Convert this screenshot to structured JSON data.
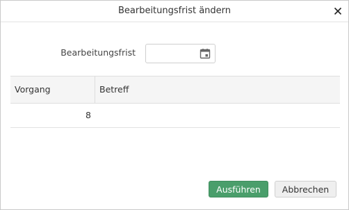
{
  "dialog": {
    "title": "Bearbeitungsfrist ändern",
    "close_icon": "close-icon"
  },
  "form": {
    "deadline_label": "Bearbeitungsfrist",
    "deadline_value": "",
    "calendar_icon": "calendar-icon"
  },
  "table": {
    "columns": [
      "Vorgang",
      "Betreff"
    ],
    "rows": [
      {
        "vorgang": "8",
        "betreff": ""
      }
    ]
  },
  "actions": {
    "execute_label": "Ausführen",
    "cancel_label": "Abbrechen"
  },
  "colors": {
    "primary_button": "#4a9e6b",
    "header_background": "#f5f5f5",
    "border": "#c9c9c9"
  }
}
